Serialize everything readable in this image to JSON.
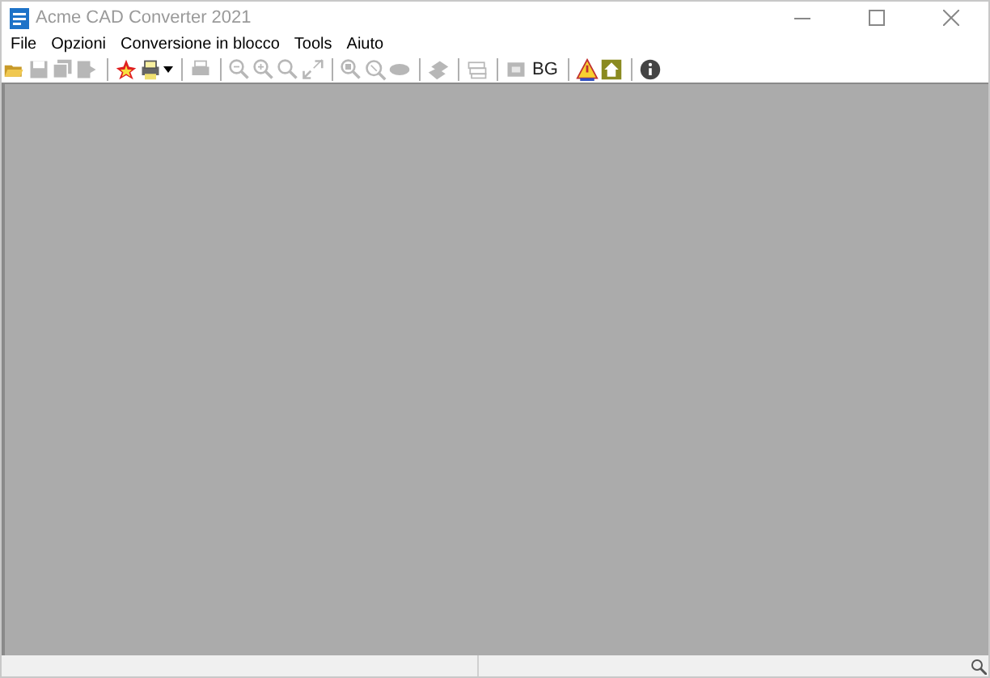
{
  "window": {
    "title": "Acme CAD Converter 2021"
  },
  "menu": [
    "File",
    "Opzioni",
    "Conversione in blocco",
    "Tools",
    "Aiuto"
  ],
  "toolbar": [
    {
      "kind": "button",
      "disabled": false
    },
    {
      "kind": "button",
      "disabled": true
    },
    {
      "kind": "button",
      "disabled": true
    },
    {
      "kind": "button",
      "disabled": true
    },
    {
      "kind": "separator"
    },
    {
      "kind": "button",
      "disabled": false
    },
    {
      "kind": "dropdown",
      "disabled": false
    },
    {
      "kind": "separator"
    },
    {
      "kind": "button",
      "disabled": true
    },
    {
      "kind": "separator"
    },
    {
      "kind": "button",
      "disabled": true
    },
    {
      "kind": "button",
      "disabled": true
    },
    {
      "kind": "button",
      "disabled": true
    },
    {
      "kind": "button",
      "disabled": true
    },
    {
      "kind": "separator"
    },
    {
      "kind": "button",
      "disabled": true
    },
    {
      "kind": "button",
      "disabled": true
    },
    {
      "kind": "button",
      "disabled": true
    },
    {
      "kind": "separator"
    },
    {
      "kind": "button",
      "disabled": true
    },
    {
      "kind": "separator"
    },
    {
      "kind": "button",
      "disabled": true
    },
    {
      "kind": "separator"
    },
    {
      "kind": "button",
      "disabled": true
    },
    {
      "kind": "text",
      "label": "BG",
      "disabled": false
    },
    {
      "kind": "separator"
    },
    {
      "kind": "button",
      "disabled": false
    },
    {
      "kind": "button",
      "disabled": false
    },
    {
      "kind": "separator"
    },
    {
      "kind": "button",
      "disabled": false
    }
  ]
}
